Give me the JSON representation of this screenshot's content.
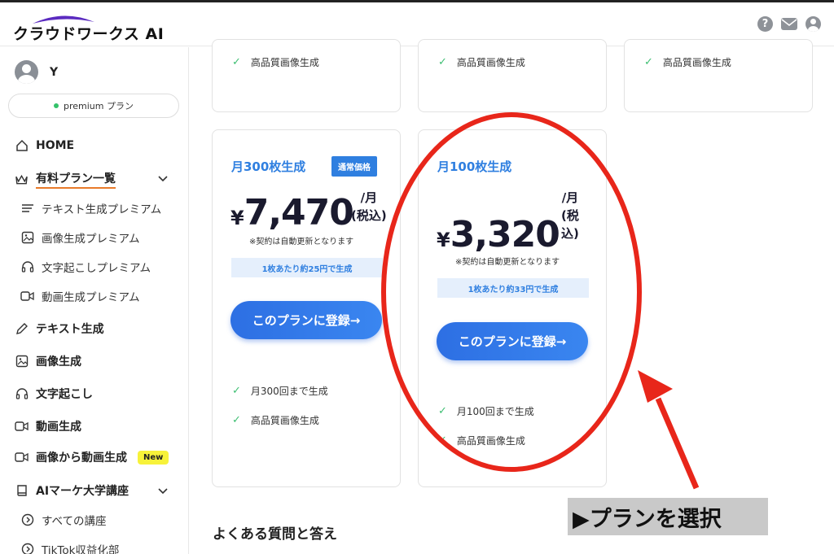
{
  "header": {
    "logo": "クラウドワークス AI",
    "icons": [
      "help-icon",
      "mail-icon",
      "account-icon"
    ],
    "help_glyph": "?"
  },
  "sidebar": {
    "user_name": "Y",
    "plan_label": "premium プラン",
    "items": [
      {
        "label": "HOME",
        "icon": "home-icon"
      },
      {
        "label": "有料プラン一覧",
        "icon": "crown-icon"
      },
      {
        "label": "テキスト生成プレミアム",
        "icon": "lines-icon"
      },
      {
        "label": "画像生成プレミアム",
        "icon": "image-icon"
      },
      {
        "label": "文字起こしプレミアム",
        "icon": "headphones-icon"
      },
      {
        "label": "動画生成プレミアム",
        "icon": "video-icon"
      },
      {
        "label": "テキスト生成",
        "icon": "pen-icon"
      },
      {
        "label": "画像生成",
        "icon": "image-icon"
      },
      {
        "label": "文字起こし",
        "icon": "headphones-icon"
      },
      {
        "label": "動画生成",
        "icon": "video-icon"
      },
      {
        "label": "画像から動画生成",
        "icon": "video-icon",
        "badge": "New"
      },
      {
        "label": "AIマーケ大学講座",
        "icon": "book-icon"
      },
      {
        "label": "すべての講座",
        "icon": "circle-chevron-icon"
      },
      {
        "label": "TikTok収益化部",
        "icon": "circle-chevron-icon"
      }
    ]
  },
  "top_cards": {
    "feature": "高品質画像生成"
  },
  "plans": [
    {
      "title": "月300枚生成",
      "badge": "通常価格",
      "yen": "¥",
      "price": "7,470",
      "per_line1": "/月",
      "per_line2": "(税込)",
      "note": "※契約は自動更新となります",
      "per_image": "1枚あたり約25円で生成",
      "cta": "このプランに登録→",
      "features": [
        "月300回まで生成",
        "高品質画像生成"
      ]
    },
    {
      "title": "月100枚生成",
      "yen": "¥",
      "price": "3,320",
      "per_line1": "/月",
      "per_line2": "(税",
      "per_line3": "込)",
      "note": "※契約は自動更新となります",
      "per_image": "1枚あたり約33円で生成",
      "cta": "このプランに登録→",
      "features": [
        "月100回まで生成",
        "高品質画像生成"
      ]
    }
  ],
  "faq_title": "よくある質問と答え",
  "annotation": {
    "label": "▶プランを選択",
    "color": "#e8261a"
  }
}
